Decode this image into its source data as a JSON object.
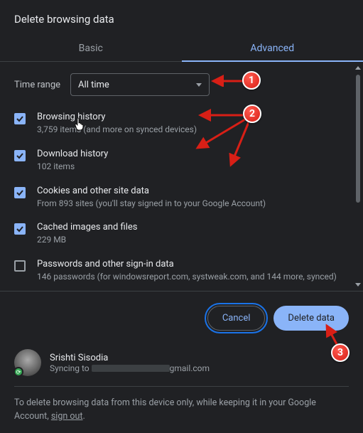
{
  "title": "Delete browsing data",
  "tabs": {
    "basic": "Basic",
    "advanced": "Advanced"
  },
  "time_range": {
    "label": "Time range",
    "selected": "All time"
  },
  "items": [
    {
      "title": "Browsing history",
      "sub": "3,759 items (and more on synced devices)",
      "checked": true
    },
    {
      "title": "Download history",
      "sub": "102 items",
      "checked": true
    },
    {
      "title": "Cookies and other site data",
      "sub": "From 893 sites (you'll stay signed in to your Google Account)",
      "checked": true
    },
    {
      "title": "Cached images and files",
      "sub": "229 MB",
      "checked": true
    },
    {
      "title": "Passwords and other sign-in data",
      "sub": "146 passwords (for windowsreport.com, systweak.com, and 144 more, synced)",
      "checked": false
    }
  ],
  "actions": {
    "cancel": "Cancel",
    "confirm": "Delete data"
  },
  "account": {
    "name": "Srishti Sisodia",
    "syncing_prefix": "Syncing to ",
    "email_suffix": "gmail.com"
  },
  "footer": {
    "text_before": "To delete browsing data from this device only, while keeping it in your Google Account, ",
    "link": "sign out",
    "text_after": "."
  },
  "annotations": {
    "b1": "1",
    "b2": "2",
    "b3": "3"
  }
}
